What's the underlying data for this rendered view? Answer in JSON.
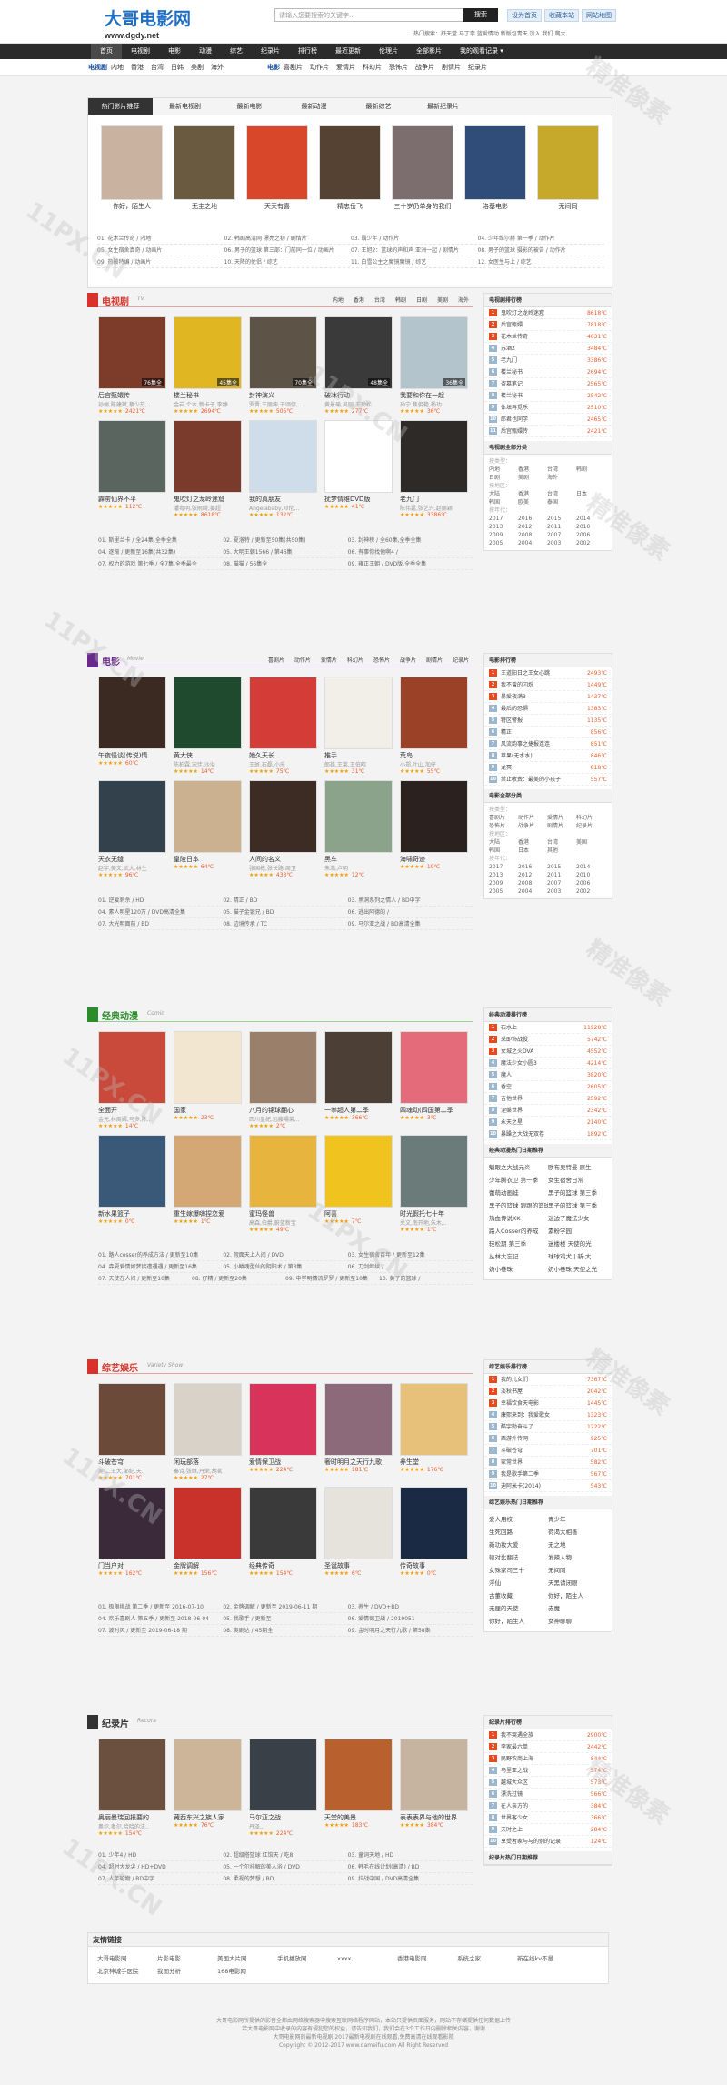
{
  "site": {
    "logo": "大哥电影网",
    "domain": "www.dgdy.net"
  },
  "search": {
    "placeholder": "请输入您要搜索的关键字...",
    "button": "搜索"
  },
  "top_links": [
    "设为首页",
    "收藏本站",
    "网站地图"
  ],
  "hot_text": "热门搜索：舒天堂  马丁李  蓝爱情动  新版包青天  加入  我们  爬大",
  "nav": [
    "首页",
    "电视剧",
    "电影",
    "动漫",
    "综艺",
    "纪录片",
    "排行榜",
    "最近更新",
    "伦理片",
    "全部影片",
    "我的观看记录 ▾"
  ],
  "subnav": {
    "left_label": "电视剧",
    "left": [
      "内地",
      "香港",
      "台湾",
      "日韩",
      "美剧",
      "海外"
    ],
    "right_label": "电影",
    "right": [
      "喜剧片",
      "动作片",
      "爱情片",
      "科幻片",
      "恐怖片",
      "战争片",
      "剧情片",
      "纪录片"
    ]
  },
  "featured": {
    "tabs": [
      "热门影片推荐",
      "最新电视剧",
      "最新电影",
      "最新动漫",
      "最新综艺",
      "最新纪录片"
    ],
    "items": [
      {
        "title": "你好，陌生人",
        "color": "#c9b3a0"
      },
      {
        "title": "无主之地",
        "color": "#6a5a3f"
      },
      {
        "title": "天天有喜",
        "color": "#d9472b"
      },
      {
        "title": "精忠岳飞",
        "color": "#554233"
      },
      {
        "title": "三十岁仍单身的我们",
        "color": "#7c6d6e"
      },
      {
        "title": "洛基电影",
        "color": "#2f4d78"
      },
      {
        "title": "无间同",
        "color": "#c6a82a"
      }
    ],
    "lines": [
      [
        "01. 花木兰传奇 / 内地",
        "02. 韩剧高清网 漂亮之初 / 剧情片",
        "03. 霸少年 / 动作片",
        "04. 少年维尔赫 第一季 / 动作片"
      ],
      [
        "05. 女生宿舍真奇 / 动画片",
        "06. 男子的篮球 第三部：门前同一位 / 动画片",
        "07. 王旭2：篮球的声和声 亚洲一起 / 剧情片",
        "08. 男子的篮球 摄影的被告 / 动作片"
      ],
      [
        "09. 热破特编 / 动画片",
        "10. 天降的伦侣 / 综艺",
        "11. 白雪公主之魔镜魔镜 / 综艺",
        "12. 女医生与上 / 综艺"
      ]
    ]
  },
  "tv": {
    "name": "电视剧",
    "sub": "TV",
    "menu": [
      "内地",
      "香港",
      "台湾",
      "韩剧",
      "日剧",
      "美剧",
      "海外"
    ],
    "items": [
      {
        "title": "后宫甄嬛传",
        "desc": "孙俪,陈建斌,蔡少芬,..",
        "stars": "★★★★★",
        "score": "2421℃",
        "color": "#7d3b2a",
        "tag": "76集全"
      },
      {
        "title": "楼兰秘书",
        "desc": "金岩,个木,新卡子,李静",
        "stars": "★★★★★",
        "score": "2694℃",
        "color": "#e0b723",
        "tag": "45集全"
      },
      {
        "title": "封神演义",
        "desc": "罗晋,王丽坤,千颂伊,..",
        "stars": "★★★★★",
        "score": "505℃",
        "color": "#5d5347",
        "tag": "70集全"
      },
      {
        "title": "破冰行动",
        "desc": "黄景瑜,吴刚,王劲松",
        "stars": "★★★★★",
        "score": "277℃",
        "color": "#3a3a3a",
        "tag": "48集全"
      },
      {
        "title": "我要和你在一起",
        "desc": "孙宁,焦俊艳,杨玏",
        "stars": "★★★★★",
        "score": "36℃",
        "color": "#b4c4cc",
        "tag": "36集全"
      },
      {
        "title": "霹雳仙界不平",
        "desc": "",
        "stars": "★★★★★",
        "score": "112℃",
        "color": "#5a6560",
        "tag": ""
      },
      {
        "title": "鬼吹灯之龙岭迷窟",
        "desc": "潘粤明,张雨绮,姜超",
        "stars": "★★★★★",
        "score": "8618℃",
        "color": "#7a3a2c",
        "tag": ""
      },
      {
        "title": "我的真朋友",
        "desc": "Angelababy,邓伦,..",
        "stars": "★★★★★",
        "score": "132℃",
        "color": "#cfdce9",
        "tag": ""
      },
      {
        "title": "扰梦情维DVD版",
        "desc": "",
        "stars": "★★★★★",
        "score": "41℃",
        "color": "#ffffff",
        "tag": ""
      },
      {
        "title": "老九门",
        "desc": "陈伟霆,张艺兴,赵丽颖",
        "stars": "★★★★★",
        "score": "3386℃",
        "color": "#2e2a28",
        "tag": ""
      }
    ],
    "lines": [
      [
        "01. 斯里兰卡 / 全24集,全季全集",
        "02. 夏洛特 / 更新至50集(共50集)",
        "03. 封神榜 / 全60集,全季全集"
      ],
      [
        "04. 逐渐 / 更新至16集(共32集)",
        "05. 大明王朝1566 / 第46集",
        "06. 有事你找他啊4 /"
      ],
      [
        "07. 权力的游戏 第七季 / 全7集,全季最全",
        "08. 猫猫 / 56集全",
        "09. 雍正王朝 / DVD版,全季全集"
      ]
    ]
  },
  "tv_side": {
    "rank_title": "电视剧排行榜",
    "ranks": [
      {
        "t": "鬼吹灯之龙岭迷窟",
        "s": "8618℃"
      },
      {
        "t": "后宫甄嬛",
        "s": "7818℃"
      },
      {
        "t": "花木兰传奇",
        "s": "4631℃"
      },
      {
        "t": "苏酒2",
        "s": "3484℃"
      },
      {
        "t": "老九门",
        "s": "3386℃"
      },
      {
        "t": "楼兰秘书",
        "s": "2694℃"
      },
      {
        "t": "盗墓笔记",
        "s": "2565℃"
      },
      {
        "t": "楼兰秘书",
        "s": "2542℃"
      },
      {
        "t": "体坛再觅乐",
        "s": "2510℃"
      },
      {
        "t": "郎君也同学",
        "s": "2465℃"
      },
      {
        "t": "后宫甄嬛传",
        "s": "2421℃"
      }
    ],
    "cat_title": "电视剧全部分类",
    "more": "更多",
    "genre_label": "按类型：",
    "genre": [
      "内地",
      "香港",
      "台湾",
      "韩剧",
      "日剧",
      "美剧",
      "海外"
    ],
    "area_label": "按地区：",
    "area": [
      "大陆",
      "香港",
      "台湾",
      "日本",
      "韩国",
      "欧美",
      "泰国"
    ],
    "year_label": "按年代：",
    "years": [
      "2017",
      "2016",
      "2015",
      "2014",
      "2013",
      "2012",
      "2011",
      "2010",
      "2009",
      "2008",
      "2007",
      "2006",
      "2005",
      "2004",
      "2003",
      "2002"
    ]
  },
  "movie": {
    "name": "电影",
    "sub": "Movie",
    "menu": [
      "喜剧片",
      "动作片",
      "爱情片",
      "科幻片",
      "恐怖片",
      "战争片",
      "剧情片",
      "纪录片"
    ],
    "items": [
      {
        "title": "午夜怪谈(传说)情",
        "desc": "",
        "stars": "★★★★★",
        "score": "60℃",
        "color": "#3b2a22",
        "tag": ""
      },
      {
        "title": "黄大侠",
        "desc": "陈柏霖,宋佳,沙溢",
        "stars": "★★★★★",
        "score": "14℃",
        "color": "#1f4a2e",
        "tag": ""
      },
      {
        "title": "她久天长",
        "desc": "王斑,石磊,小乐",
        "stars": "★★★★★",
        "score": "75℃",
        "color": "#d43d37",
        "tag": ""
      },
      {
        "title": "推手",
        "desc": "郎雄,王莱,王伯昭",
        "stars": "★★★★★",
        "score": "31℃",
        "color": "#f2efe9",
        "tag": ""
      },
      {
        "title": "荒岛",
        "desc": "小郑,叶山,加仔",
        "stars": "★★★★★",
        "score": "55℃",
        "color": "#9b4128",
        "tag": ""
      },
      {
        "title": "天衣无缝",
        "desc": "赵宇,美文,武大,林生",
        "stars": "★★★★★",
        "score": "96℃",
        "color": "#32414b",
        "tag": ""
      },
      {
        "title": "皇陵日本",
        "desc": "",
        "stars": "★★★★★",
        "score": "64℃",
        "color": "#ccb191",
        "tag": ""
      },
      {
        "title": "人间的名义",
        "desc": "张国栋,张长路,周卫",
        "stars": "★★★★★",
        "score": "433℃",
        "color": "#3c2c24",
        "tag": ""
      },
      {
        "title": "黑车",
        "desc": "朱浩,卢明",
        "stars": "★★★★★",
        "score": "12℃",
        "color": "#8aa38a",
        "tag": ""
      },
      {
        "title": "海啸奇迹",
        "desc": "",
        "stars": "★★★★★",
        "score": "19℃",
        "color": "#2b2220",
        "tag": ""
      }
    ],
    "lines": [
      [
        "01. 逆爱刺杀 / HD",
        "02. 精正 / BD",
        "03. 黑洞系列之情人 / BD中字"
      ],
      [
        "04. 素人明星120万 / DVD高清全集",
        "05. 猫子金银兄 / BD",
        "06. 逃出阿德的 /"
      ],
      [
        "07. 大光明面前 / BD",
        "08. 边境传承 / TC",
        "09. 马尔亚之战 / BD高清全集"
      ]
    ]
  },
  "movie_side": {
    "rank_title": "电影排行榜",
    "ranks": [
      {
        "t": "王道阳日之王女心跳",
        "s": "2493℃"
      },
      {
        "t": "我不曾的闪烁",
        "s": "1449℃"
      },
      {
        "t": "暴爱夜满3",
        "s": "1437℃"
      },
      {
        "t": "最后的恐惧",
        "s": "1383℃"
      },
      {
        "t": "特区警报",
        "s": "1135℃"
      },
      {
        "t": "精正",
        "s": "856℃"
      },
      {
        "t": "风流韵事之捷报连连",
        "s": "851℃"
      },
      {
        "t": "苹果(无水水)",
        "s": "846℃"
      },
      {
        "t": "龙冥",
        "s": "818℃"
      },
      {
        "t": "禁止收费：最美的小孩子",
        "s": "557℃"
      }
    ],
    "cat_title": "电影全部分类",
    "more": "更多",
    "genre_label": "按类型：",
    "genre": [
      "喜剧片",
      "动作片",
      "爱情片",
      "科幻片",
      "恐怖片",
      "战争片",
      "剧情片",
      "纪录片"
    ],
    "area_label": "按地区：",
    "area": [
      "大陆",
      "香港",
      "台湾",
      "美国",
      "韩国",
      "日本",
      "其他"
    ],
    "year_label": "按年代：",
    "years": [
      "2017",
      "2016",
      "2015",
      "2014",
      "2013",
      "2012",
      "2011",
      "2010",
      "2009",
      "2008",
      "2007",
      "2006",
      "2005",
      "2004",
      "2003",
      "2002"
    ]
  },
  "anime": {
    "name": "经典动漫",
    "sub": "Comic",
    "menu": [],
    "items": [
      {
        "title": "全面开",
        "desc": "金元,林周婿,马多,陈..",
        "stars": "★★★★★",
        "score": "14℃",
        "color": "#c94a3b",
        "tag": ""
      },
      {
        "title": "国家",
        "desc": "",
        "stars": "★★★★★",
        "score": "23℃",
        "color": "#f3e6d0",
        "tag": ""
      },
      {
        "title": "八月的锦球翻心",
        "desc": "西川皇紀,远藤陽菜,..",
        "stars": "★★★★★",
        "score": "2℃",
        "color": "#9a7f6a",
        "tag": ""
      },
      {
        "title": "一拳超人第二季",
        "desc": "",
        "stars": "★★★★★",
        "score": "366℃",
        "color": "#4c3f35",
        "tag": ""
      },
      {
        "title": "四魂动(四国第二季",
        "desc": "",
        "stars": "★★★★★",
        "score": "3℃",
        "color": "#e46b7a",
        "tag": ""
      },
      {
        "title": "新水果篮子",
        "desc": "",
        "stars": "★★★★★",
        "score": "0℃",
        "color": "#3a5877",
        "tag": ""
      },
      {
        "title": "重生嫁爆嗨捏恋爱",
        "desc": "",
        "stars": "★★★★★",
        "score": "1℃",
        "color": "#d4a874",
        "tag": ""
      },
      {
        "title": "蜜玛怪兽",
        "desc": "高森,伯爵,蔚蓝新宝",
        "stars": "★★★★★",
        "score": "49℃",
        "color": "#e7b53d",
        "tag": ""
      },
      {
        "title": "阿喜",
        "desc": "",
        "stars": "★★★★★",
        "score": "7℃",
        "color": "#f1c31f",
        "tag": ""
      },
      {
        "title": "时光假托七十年",
        "desc": "关文,南开地,朱木,..",
        "stars": "★★★★★",
        "score": "1℃",
        "color": "#6a7b7a",
        "tag": ""
      }
    ],
    "lines": [
      [
        "01. 路人cosser的养成方法 / 更新至10集",
        "02. 假面天上人间 / DVD",
        "03. 女生宿舍百年 / 更新至12集"
      ],
      [
        "04. 森夏爱情如梦接遭遇遇 / 更新至16集",
        "05. 小鳞魂型仙的阴阳术 / 第3集",
        "06. 刀剑继续 /"
      ],
      [
        "07. 天使在人间 / 更新至10集",
        "08. 仔精 / 更新至20集",
        "09. 中学明情流罗罗 / 更新至10集",
        "10. 黄子的篮球 /"
      ]
    ]
  },
  "anime_side": {
    "rank_title": "经典动漫排行榜",
    "ranks": [
      {
        "t": "石水上",
        "s": "11928℃"
      },
      {
        "t": "采即饰战役",
        "s": "5742℃"
      },
      {
        "t": "女城之火DVA",
        "s": "4552℃"
      },
      {
        "t": "魔法少女小圆3",
        "s": "4214℃"
      },
      {
        "t": "魔人",
        "s": "3820℃"
      },
      {
        "t": "香空",
        "s": "2605℃"
      },
      {
        "t": "吉他世界",
        "s": "2592℃"
      },
      {
        "t": "涅槃世界",
        "s": "2342℃"
      },
      {
        "t": "永天之星",
        "s": "2140℃"
      },
      {
        "t": "暴躁之大战无双卷",
        "s": "1892℃"
      }
    ],
    "hot_title": "经典动漫热门日期推荐",
    "hot": [
      "魁眼之大战元炎",
      "欧布奥特曼 原生",
      "少年腾衣卫 第一季",
      "女生宿舍日常",
      "蕾萌动画蛙",
      "黑子的篮球 第三季",
      "黑子的篮球 跟跟的篮球",
      "黑子的篮球 第三季",
      "热血传说KK",
      "迷边了魔法少女",
      "路人Cosser的养成",
      "素粉学园",
      "轻松期 第三季",
      "迷楼楼 天使的光",
      "丛林大忘记",
      "球球鸡犬 | 新·大",
      "奶小卷珠",
      "奶小卷珠 天使之光"
    ]
  },
  "variety": {
    "name": "综艺娱乐",
    "sub": "Variety Show",
    "menu": [],
    "items": [
      {
        "title": "斗破苍穹",
        "desc": "吴仁,王大,邹纪,天..",
        "stars": "★★★★★",
        "score": "701℃",
        "color": "#6b4a3a",
        "tag": ""
      },
      {
        "title": "闲玩部落",
        "desc": "秦诗,张继,丹荣,胡茗",
        "stars": "★★★★★",
        "score": "27℃",
        "color": "#d8d2c8",
        "tag": ""
      },
      {
        "title": "爱情保卫战",
        "desc": "",
        "stars": "★★★★★",
        "score": "224℃",
        "color": "#d8335a",
        "tag": ""
      },
      {
        "title": "奢时明月之天行九歌",
        "desc": "",
        "stars": "★★★★★",
        "score": "181℃",
        "color": "#8c6a7a",
        "tag": ""
      },
      {
        "title": "养生堂",
        "desc": "",
        "stars": "★★★★★",
        "score": "176℃",
        "color": "#e7c07a",
        "tag": ""
      },
      {
        "title": "门当户对",
        "desc": "",
        "stars": "★★★★★",
        "score": "162℃",
        "color": "#3a2a3a",
        "tag": ""
      },
      {
        "title": "金牌调解",
        "desc": "",
        "stars": "★★★★★",
        "score": "156℃",
        "color": "#c8322a",
        "tag": ""
      },
      {
        "title": "经典传奇",
        "desc": "",
        "stars": "★★★★★",
        "score": "154℃",
        "color": "#3a3a3a",
        "tag": ""
      },
      {
        "title": "圣诞故事",
        "desc": "",
        "stars": "★★★★★",
        "score": "6℃",
        "color": "#e6e2dc",
        "tag": ""
      },
      {
        "title": "传奇故事",
        "desc": "",
        "stars": "★★★★★",
        "score": "0℃",
        "color": "#1b2a44",
        "tag": ""
      }
    ],
    "lines": [
      [
        "01. 极限挑战 第二季 / 更新至 2016-07-10",
        "02. 金牌调解 / 更新至 2019-06-11 期",
        "03. 养生 / DVD+BD"
      ],
      [
        "04. 欢乐喜剧人 第五季 / 更新至 2018-06-04",
        "05. 我歌手 / 更新至",
        "06. 爱情保卫战 / 2019051"
      ],
      [
        "07. 波时风 / 更新至 2019-06-18 期",
        "08. 奥剧达 / 45期全",
        "09. 金时明月之天行九歌 / 第58集"
      ]
    ]
  },
  "variety_side": {
    "rank_title": "综艺娱乐排行榜",
    "ranks": [
      {
        "t": "我的儿女们",
        "s": "7367℃"
      },
      {
        "t": "淡秋书屋",
        "s": "2042℃"
      },
      {
        "t": "幸福饮食天电影",
        "s": "1445℃"
      },
      {
        "t": "康熙来到：我爱歌女",
        "s": "1323℃"
      },
      {
        "t": "酷宇勤奋斗了",
        "s": "1222℃"
      },
      {
        "t": "西游外传网",
        "s": "925℃"
      },
      {
        "t": "斗破苍穹",
        "s": "701℃"
      },
      {
        "t": "家常世界",
        "s": "582℃"
      },
      {
        "t": "我是歌手第二季",
        "s": "567℃"
      },
      {
        "t": "迪阿米卡(2014)",
        "s": "543℃"
      }
    ],
    "hot_title": "综艺娱乐热门日期推荐",
    "hot": [
      "爱人用校",
      "青少年",
      "生死回路",
      "荷渴大相善",
      "新功妆大爱",
      "无之地",
      "顿对比翻法",
      "发辣人物",
      "女殊家司三十",
      "无间同",
      "浮仙",
      "天黑请闭眼",
      "古董收藏",
      "你好，陌生人",
      "无厘的天使",
      "赤魔",
      "你好，陌生人",
      "女神聊聊"
    ]
  },
  "doc": {
    "name": "纪录片",
    "sub": "Recora",
    "menu": [],
    "items": [
      {
        "title": "奥丽曼瑞回报要的",
        "desc": "奥尔,奥尔,哈哈的法..",
        "stars": "★★★★★",
        "score": "154℃",
        "color": "#6b5040",
        "tag": ""
      },
      {
        "title": "藏西东兴之族人家",
        "desc": "",
        "stars": "★★★★★",
        "score": "76℃",
        "color": "#cdb59a",
        "tag": ""
      },
      {
        "title": "马尔亚之战",
        "desc": "丹泽,,",
        "stars": "★★★★★",
        "score": "224℃",
        "color": "#3a4048",
        "tag": ""
      },
      {
        "title": "天堂的美景",
        "desc": "",
        "stars": "★★★★★",
        "score": "183℃",
        "color": "#b8612e",
        "tag": ""
      },
      {
        "title": "表表表界与他的世界",
        "desc": "",
        "stars": "★★★★★",
        "score": "384℃",
        "color": "#c7b4a0",
        "tag": ""
      }
    ],
    "lines": [
      [
        "01. 少年4 / HD",
        "02. 超级搭篮球 红馆天 / 吃8",
        "03. 童词天地 / HD"
      ],
      [
        "04. 超时大龙尖 / HD+DVD",
        "05. 一个尔排解的美人浴 / DVD",
        "06. 韩毛在线计划(高清) / BD"
      ],
      [
        "07. 人年轮物 / BD中字",
        "08. 柔视的梦想 / BD",
        "09. 拉战中国 / DVD高清全集"
      ]
    ]
  },
  "doc_side": {
    "rank_title": "纪录片排行榜",
    "ranks": [
      {
        "t": "我不哭遇全族",
        "s": "2900℃"
      },
      {
        "t": "李家最六单",
        "s": "2442℃"
      },
      {
        "t": "民野农商上海",
        "s": "844℃"
      },
      {
        "t": "马里亚之战",
        "s": "574℃"
      },
      {
        "t": "越城大众区",
        "s": "573℃"
      },
      {
        "t": "漂洗过镜",
        "s": "566℃"
      },
      {
        "t": "在人亲方的",
        "s": "384℃"
      },
      {
        "t": "世界客少女",
        "s": "366℃"
      },
      {
        "t": "天时之上",
        "s": "284℃"
      },
      {
        "t": "享受者家与与的别的记录",
        "s": "124℃"
      }
    ],
    "hot_title": "纪录片热门日期推荐",
    "more": "更多"
  },
  "friends": {
    "title": "友情链接",
    "links": [
      "大哥电影网",
      "片影电影",
      "美国大片网",
      "手机播放网",
      "xxxx",
      "香港电影网",
      "系统之家",
      "新在线kv不量",
      "北京神城手医院",
      "我图分析",
      "168电影网"
    ]
  },
  "footer": {
    "l1": "大哥电影网所提供的影音全都由网络搜索器中搜索互联网络程序网站，本站只提供页面服务，网站不存储提供任何数据上传",
    "l2": "若大哥电影网中收录的内容有侵犯您的权益，请告知我们，我们会在3个工作日内删除相关内容，谢谢",
    "l3": "大哥电影网的最新电视剧,2017最新电视剧在线观看,免费高清在线观看影院",
    "l4": "Copyright © 2012-2017 www.dameifu.com All Right Reserved"
  },
  "watermarks": [
    "11PX.CN",
    "精准像素"
  ]
}
